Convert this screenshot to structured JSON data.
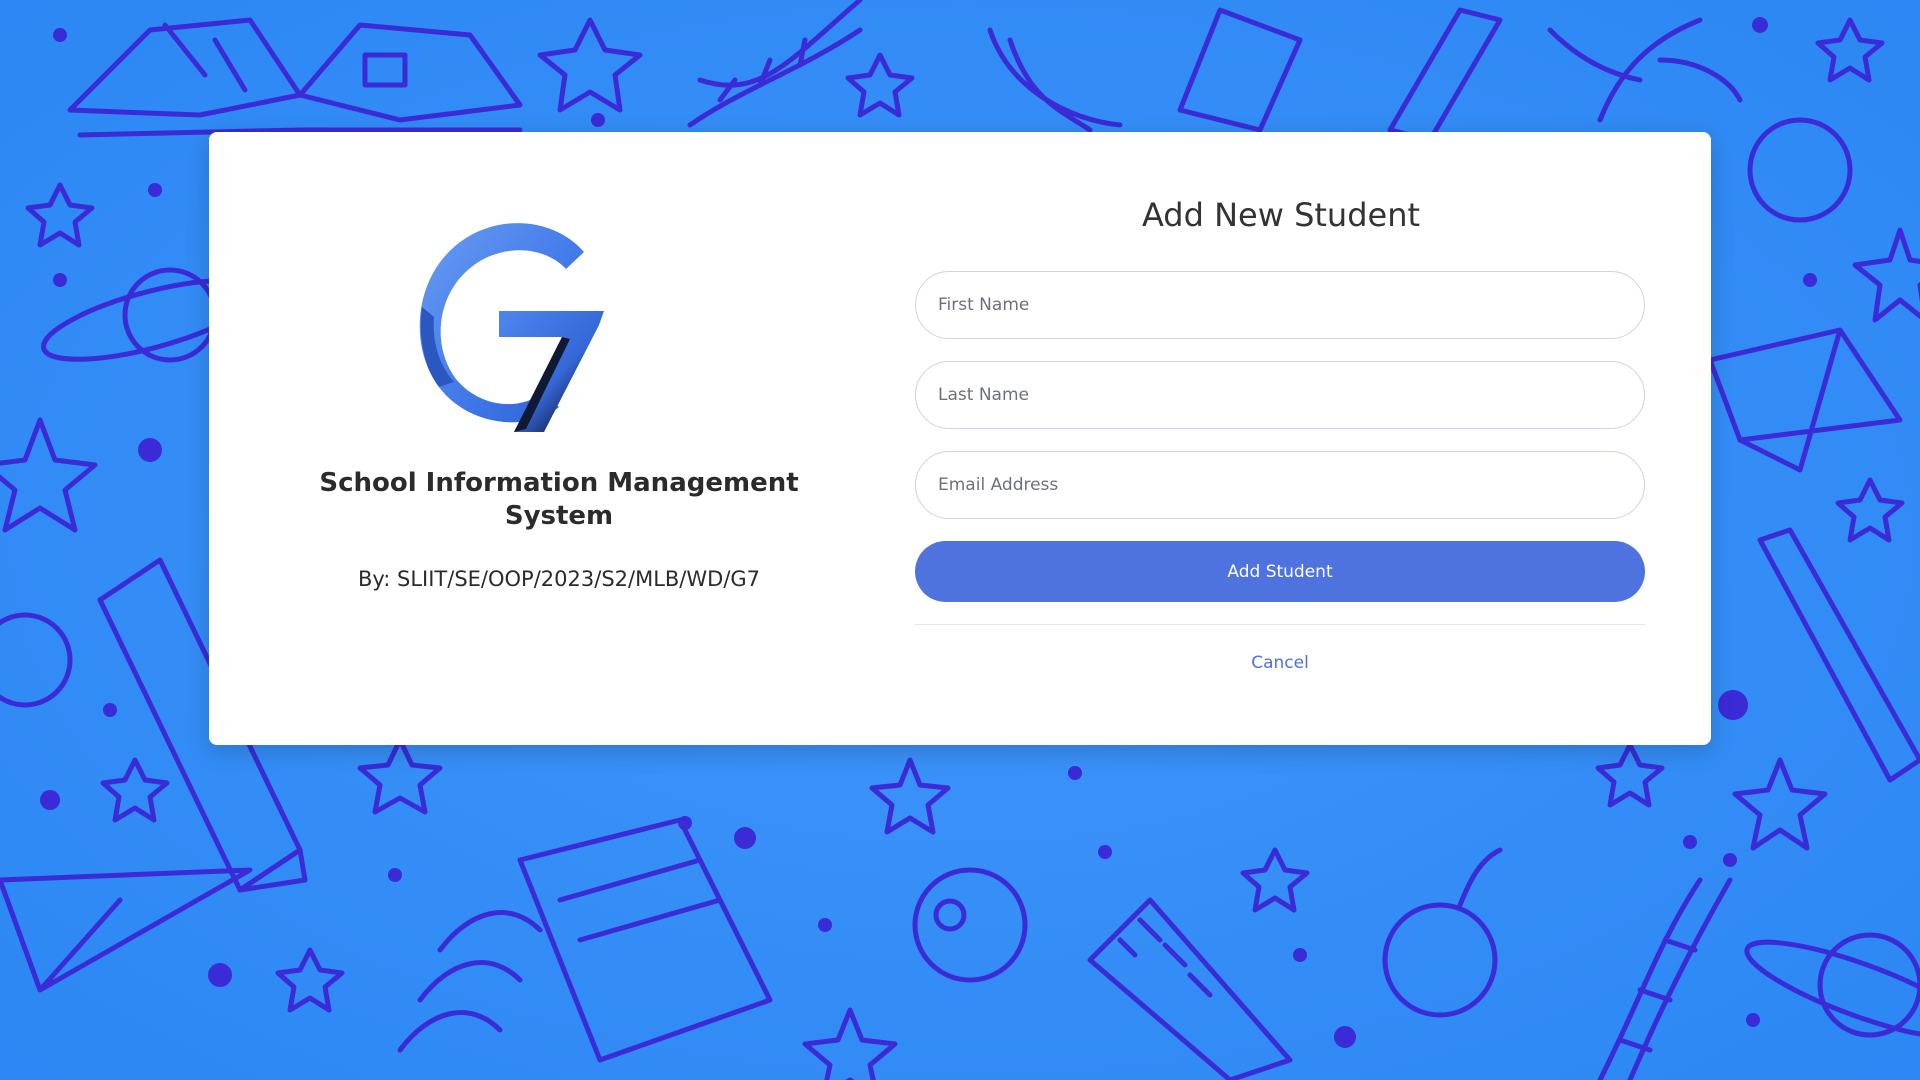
{
  "brand": {
    "logo_icon": "g7-logo-icon",
    "logo_text": "G7",
    "app_title": "School Information Management System",
    "byline": "By: SLIIT/SE/OOP/2023/S2/MLB/WD/G7"
  },
  "form": {
    "title": "Add New Student",
    "first_name_placeholder": "First Name",
    "last_name_placeholder": "Last Name",
    "email_placeholder": "Email Address",
    "submit_label": "Add Student",
    "cancel_label": "Cancel"
  },
  "colors": {
    "background": "#2f8bf6",
    "doodle": "#3a2bd6",
    "primary_button": "#4e73df",
    "link": "#4e73df",
    "card": "#ffffff"
  }
}
